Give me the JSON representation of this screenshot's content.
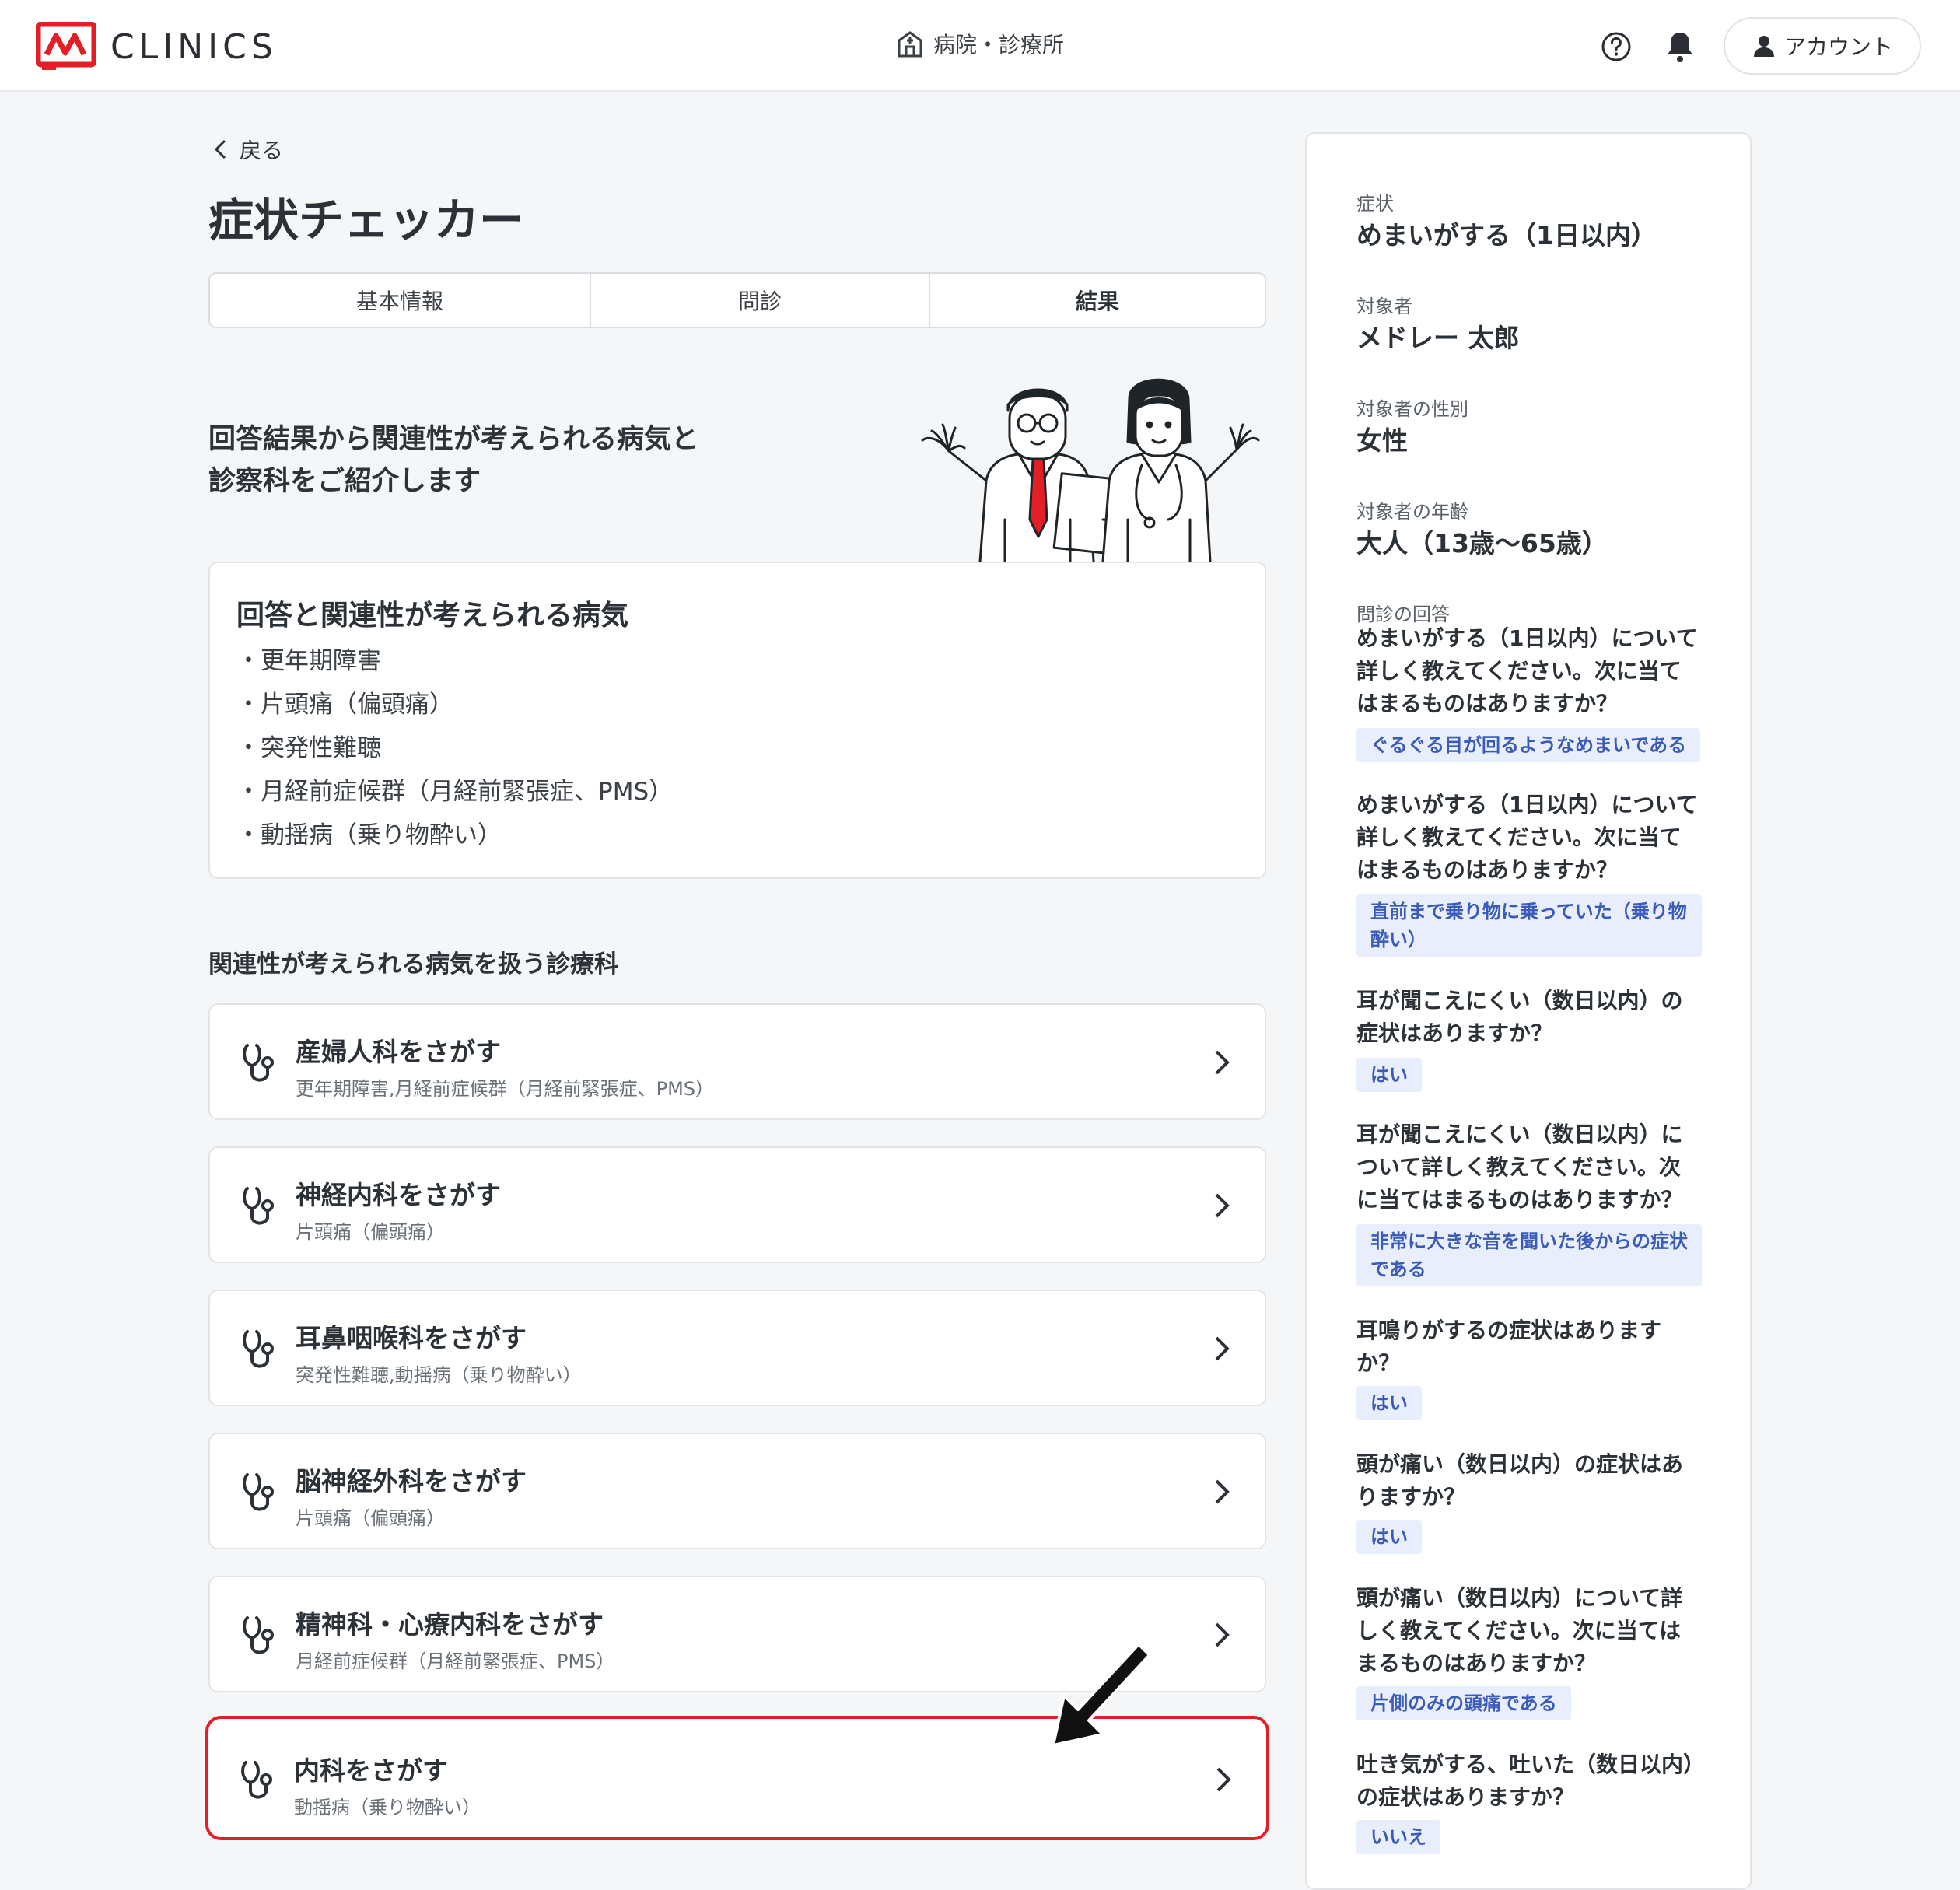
{
  "header": {
    "brand": "CLINICS",
    "center_link": "病院・診療所",
    "account_label": "アカウント"
  },
  "nav": {
    "back_label": "戻る"
  },
  "page": {
    "title": "症状チェッカー"
  },
  "tabs": [
    {
      "label": "基本情報"
    },
    {
      "label": "問診"
    },
    {
      "label": "結果",
      "active": true
    }
  ],
  "intro": {
    "line1": "回答結果から関連性が考えられる病気と",
    "line2": "診察科をご紹介します"
  },
  "diseases": {
    "title": "回答と関連性が考えられる病気",
    "items": [
      "・更年期障害",
      "・片頭痛（偏頭痛）",
      "・突発性難聴",
      "・月経前症候群（月経前緊張症、PMS）",
      "・動揺病（乗り物酔い）"
    ]
  },
  "departments": {
    "heading": "関連性が考えられる病気を扱う診療科",
    "items": [
      {
        "name": "産婦人科をさがす",
        "desc": "更年期障害,月経前症候群（月経前緊張症、PMS）"
      },
      {
        "name": "神経内科をさがす",
        "desc": "片頭痛（偏頭痛）"
      },
      {
        "name": "耳鼻咽喉科をさがす",
        "desc": "突発性難聴,動揺病（乗り物酔い）"
      },
      {
        "name": "脳神経外科をさがす",
        "desc": "片頭痛（偏頭痛）"
      },
      {
        "name": "精神科・心療内科をさがす",
        "desc": "月経前症候群（月経前緊張症、PMS）"
      },
      {
        "name": "内科をさがす",
        "desc": "動揺病（乗り物酔い）",
        "highlighted": true
      }
    ]
  },
  "summary": {
    "symptom_label": "症状",
    "symptom": "めまいがする（1日以内）",
    "subject_label": "対象者",
    "subject": "メドレー 太郎",
    "sex_label": "対象者の性別",
    "sex": "女性",
    "age_label": "対象者の年齢",
    "age": "大人（13歳〜65歳）",
    "answers_label": "問診の回答",
    "qa": [
      {
        "q": [
          "めまいがする（1日以内）について",
          "詳しく教えてください。次に当て",
          "はまるものはありますか？"
        ],
        "a": [
          "ぐるぐる目が回るようなめまいである"
        ]
      },
      {
        "q": [
          "めまいがする（1日以内）について",
          "詳しく教えてください。次に当て",
          "はまるものはありますか？"
        ],
        "a": [
          "直前まで乗り物に乗っていた（乗り物",
          "酔い）"
        ]
      },
      {
        "q": [
          "耳が聞こえにくい（数日以内）の",
          "症状はありますか？"
        ],
        "a": [
          "はい"
        ]
      },
      {
        "q": [
          "耳が聞こえにくい（数日以内）に",
          "ついて詳しく教えてください。次",
          "に当てはまるものはありますか？"
        ],
        "a": [
          "非常に大きな音を聞いた後からの症状",
          "である"
        ]
      },
      {
        "q": [
          "耳鳴りがするの症状はあります",
          "か？"
        ],
        "a": [
          "はい"
        ]
      },
      {
        "q": [
          "頭が痛い（数日以内）の症状はあ",
          "りますか？"
        ],
        "a": [
          "はい"
        ]
      },
      {
        "q": [
          "頭が痛い（数日以内）について詳",
          "しく教えてください。次に当ては",
          "まるものはありますか？"
        ],
        "a": [
          "片側のみの頭痛である"
        ]
      },
      {
        "q": [
          "吐き気がする、吐いた（数日以内）",
          "の症状はありますか？"
        ],
        "a": [
          "いいえ"
        ]
      }
    ]
  },
  "colors": {
    "brand_red": "#e21f26",
    "highlight_border": "#e21f26",
    "answer_chip_bg": "#e8eefb",
    "answer_chip_text": "#3b5bb8"
  },
  "icons": [
    "clinics-logo",
    "hospital-icon",
    "help-icon",
    "bell-icon",
    "user-icon",
    "chevron-left-icon",
    "stethoscope-icon",
    "chevron-right-icon",
    "pointer-arrow-icon"
  ]
}
